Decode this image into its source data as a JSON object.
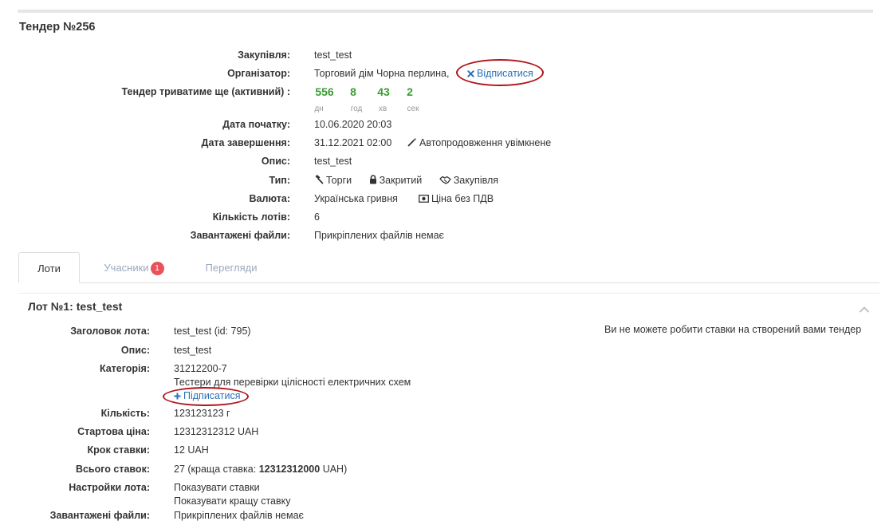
{
  "page": {
    "title": "Тендер №256"
  },
  "tender": {
    "purchase_label": "Закупівля:",
    "purchase_value": "test_test",
    "organizer_label": "Організатор:",
    "organizer_value": "Торговий дім Чорна перлина,",
    "unsubscribe_label": "Відписатися",
    "duration_label": "Тендер триватиме ще",
    "duration_status": "(активний)",
    "duration_colon": ":",
    "timer": {
      "days": "556",
      "hours": "8",
      "minutes": "43",
      "seconds": "2",
      "days_label": "дн",
      "hours_label": "год",
      "minutes_label": "хв",
      "seconds_label": "сек"
    },
    "start_label": "Дата початку:",
    "start_value": "10.06.2020 20:03",
    "end_label": "Дата завершення:",
    "end_value": "31.12.2021 02:00",
    "autoextend_label": "Автопродовження увімкнене",
    "description_label": "Опис:",
    "description_value": "test_test",
    "type_label": "Тип:",
    "type_items": [
      "Торги",
      "Закритий",
      "Закупівля"
    ],
    "currency_label": "Валюта:",
    "currency_value": "Українська гривня",
    "vat_label": "Ціна без ПДВ",
    "lots_count_label": "Кількість лотів:",
    "lots_count_value": "6",
    "files_label": "Завантажені файли:",
    "files_value": "Прикріплених файлів немає"
  },
  "tabs": {
    "lots": "Лоти",
    "participants": "Учасники",
    "participants_badge": "1",
    "views": "Перегляди"
  },
  "lot": {
    "title": "Лот №1: test_test",
    "notice": "Ви не можете робити ставки на створений вами тендер",
    "heading_label": "Заголовок лота:",
    "heading_value": "test_test (id: 795)",
    "description_label": "Опис:",
    "description_value": "test_test",
    "category_label": "Категорія:",
    "category_code": "31212200-7",
    "category_name": "Тестери для перевірки цілісності електричних схем",
    "subscribe_label": "Підписатися",
    "quantity_label": "Кількість:",
    "quantity_value": "123123123 г",
    "start_price_label": "Стартова ціна:",
    "start_price_value": "12312312312 UAH",
    "step_label": "Крок ставки:",
    "step_value": "12 UAH",
    "bids_label": "Всього ставок:",
    "bids_count": "27",
    "bids_best_prefix": "(краща ставка:",
    "bids_best_value": "12312312000",
    "bids_best_suffix": "UAH)",
    "settings_label": "Настройки лота:",
    "settings_items": [
      "Показувати ставки",
      "Показувати кращу ставку"
    ],
    "files_label": "Завантажені файли:",
    "files_value": "Прикріплених файлів немає"
  }
}
